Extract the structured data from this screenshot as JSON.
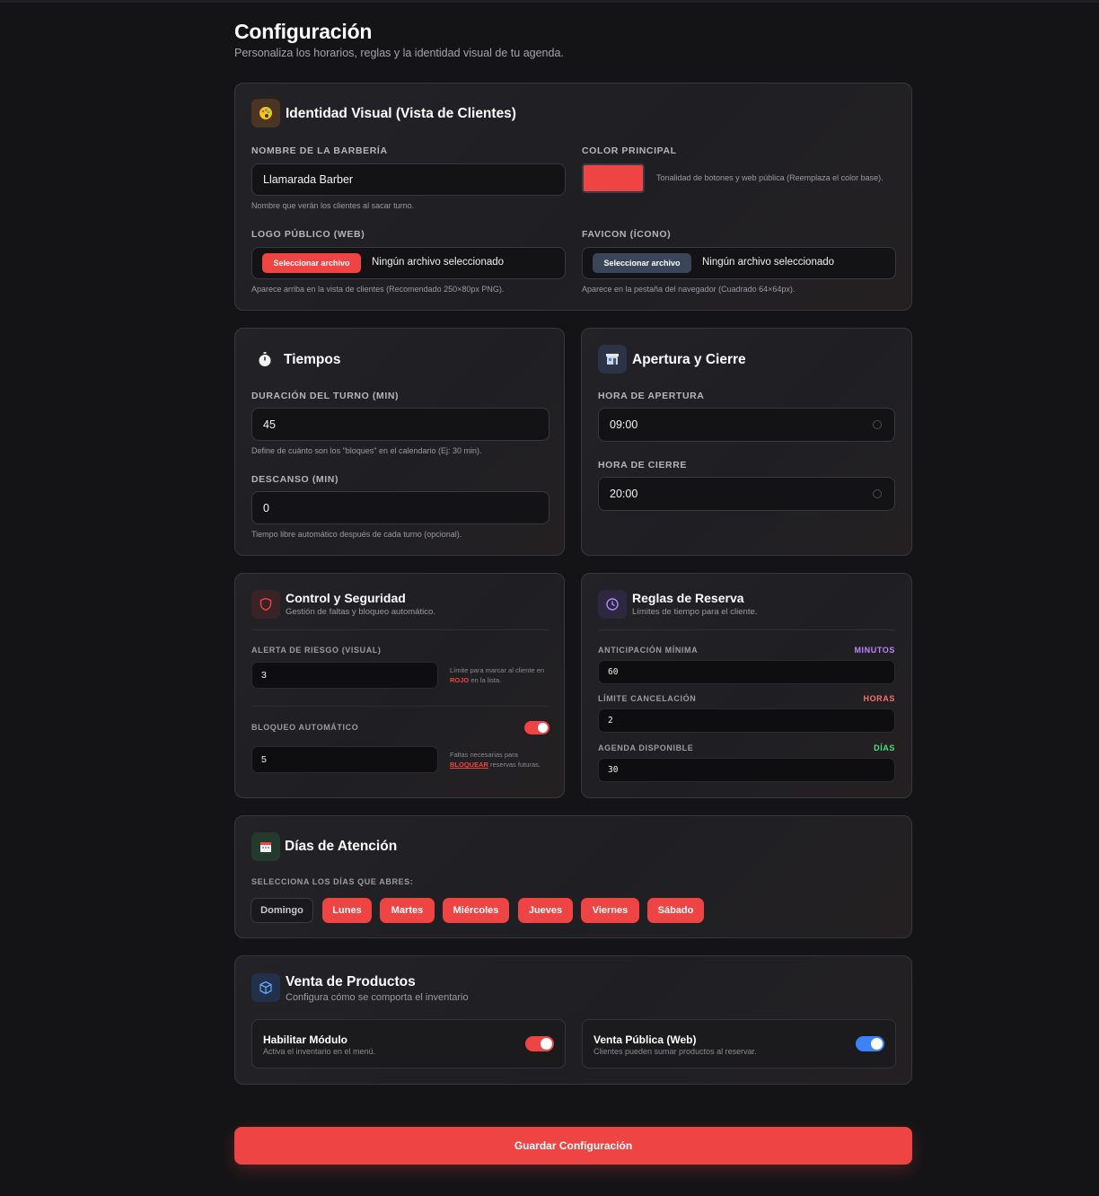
{
  "page": {
    "title": "Configuración",
    "subtitle": "Personaliza los horarios, reglas y la identidad visual de tu agenda."
  },
  "identity": {
    "title": "Identidad Visual (Vista de Clientes)",
    "icon": "palette-icon",
    "name_label": "Nombre de la Barbería",
    "name_value": "Llamarada Barber",
    "name_hint": "Nombre que verán los clientes al sacar turno.",
    "color_label": "Color Principal",
    "color_value": "#ef4444",
    "color_hint": "Tonalidad de botones y web pública (Reemplaza el color base).",
    "logo_label": "Logo Público (Web)",
    "logo_button": "Seleccionar archivo",
    "logo_file": "Ningún archivo seleccionado",
    "logo_hint": "Aparece arriba en la vista de clientes (Recomendado 250×80px PNG).",
    "favicon_label": "Favicon (Ícono)",
    "favicon_button": "Seleccionar archivo",
    "favicon_file": "Ningún archivo seleccionado",
    "favicon_hint": "Aparece en la pestaña del navegador (Cuadrado 64×64px)."
  },
  "times": {
    "title": "Tiempos",
    "icon": "stopwatch-icon",
    "duration_label": "Duración del Turno (Min)",
    "duration_value": "45",
    "duration_hint": "Define de cuánto son los \"bloques\" en el calendario (Ej: 30 min).",
    "break_label": "Descanso (Min)",
    "break_value": "0",
    "break_hint": "Tiempo libre automático después de cada turno (opcional)."
  },
  "hours": {
    "title": "Apertura y Cierre",
    "icon": "store-icon",
    "open_label": "Hora de Apertura",
    "open_value": "09:00",
    "close_label": "Hora de Cierre",
    "close_value": "20:00"
  },
  "security": {
    "title": "Control y Seguridad",
    "subtitle": "Gestión de faltas y bloqueo automático.",
    "icon": "shield-icon",
    "risk_label": "Alerta de Riesgo (Visual)",
    "risk_value": "3",
    "risk_hint_pre": "Límite para marcar al cliente en",
    "risk_hint_red": "ROJO",
    "risk_hint_post": "en la lista.",
    "block_label": "Bloqueo Automático",
    "block_enabled": true,
    "block_value": "5",
    "block_hint_pre": "Faltas necesarias para",
    "block_hint_red": "BLOQUEAR",
    "block_hint_post": "reservas futuras."
  },
  "booking": {
    "title": "Reglas de Reserva",
    "subtitle": "Límites de tiempo para el cliente.",
    "icon": "clock-icon",
    "rows": [
      {
        "label": "Anticipación Mínima",
        "unit": "Minutos",
        "unit_color": "#c084fc",
        "value": "60"
      },
      {
        "label": "Límite Cancelación",
        "unit": "Horas",
        "unit_color": "#f87171",
        "value": "2"
      },
      {
        "label": "Agenda Disponible",
        "unit": "Días",
        "unit_color": "#4ade80",
        "value": "30"
      }
    ]
  },
  "days": {
    "title": "Días de Atención",
    "icon": "calendar-icon",
    "label": "Selecciona los días que abres:",
    "items": [
      {
        "label": "Domingo",
        "active": false
      },
      {
        "label": "Lunes",
        "active": true
      },
      {
        "label": "Martes",
        "active": true
      },
      {
        "label": "Miércoles",
        "active": true
      },
      {
        "label": "Jueves",
        "active": true
      },
      {
        "label": "Viernes",
        "active": true
      },
      {
        "label": "Sábado",
        "active": true
      }
    ]
  },
  "products": {
    "title": "Venta de Productos",
    "subtitle": "Configura cómo se comporta el inventario",
    "icon": "box-icon",
    "module_title": "Habilitar Módulo",
    "module_sub": "Activa el inventario en el menú.",
    "module_enabled": true,
    "module_color": "#ef4444",
    "public_title": "Venta Pública (Web)",
    "public_sub": "Clientes pueden sumar productos al reservar.",
    "public_enabled": true,
    "public_color": "#3b82f6"
  },
  "save_button": "Guardar Configuración"
}
